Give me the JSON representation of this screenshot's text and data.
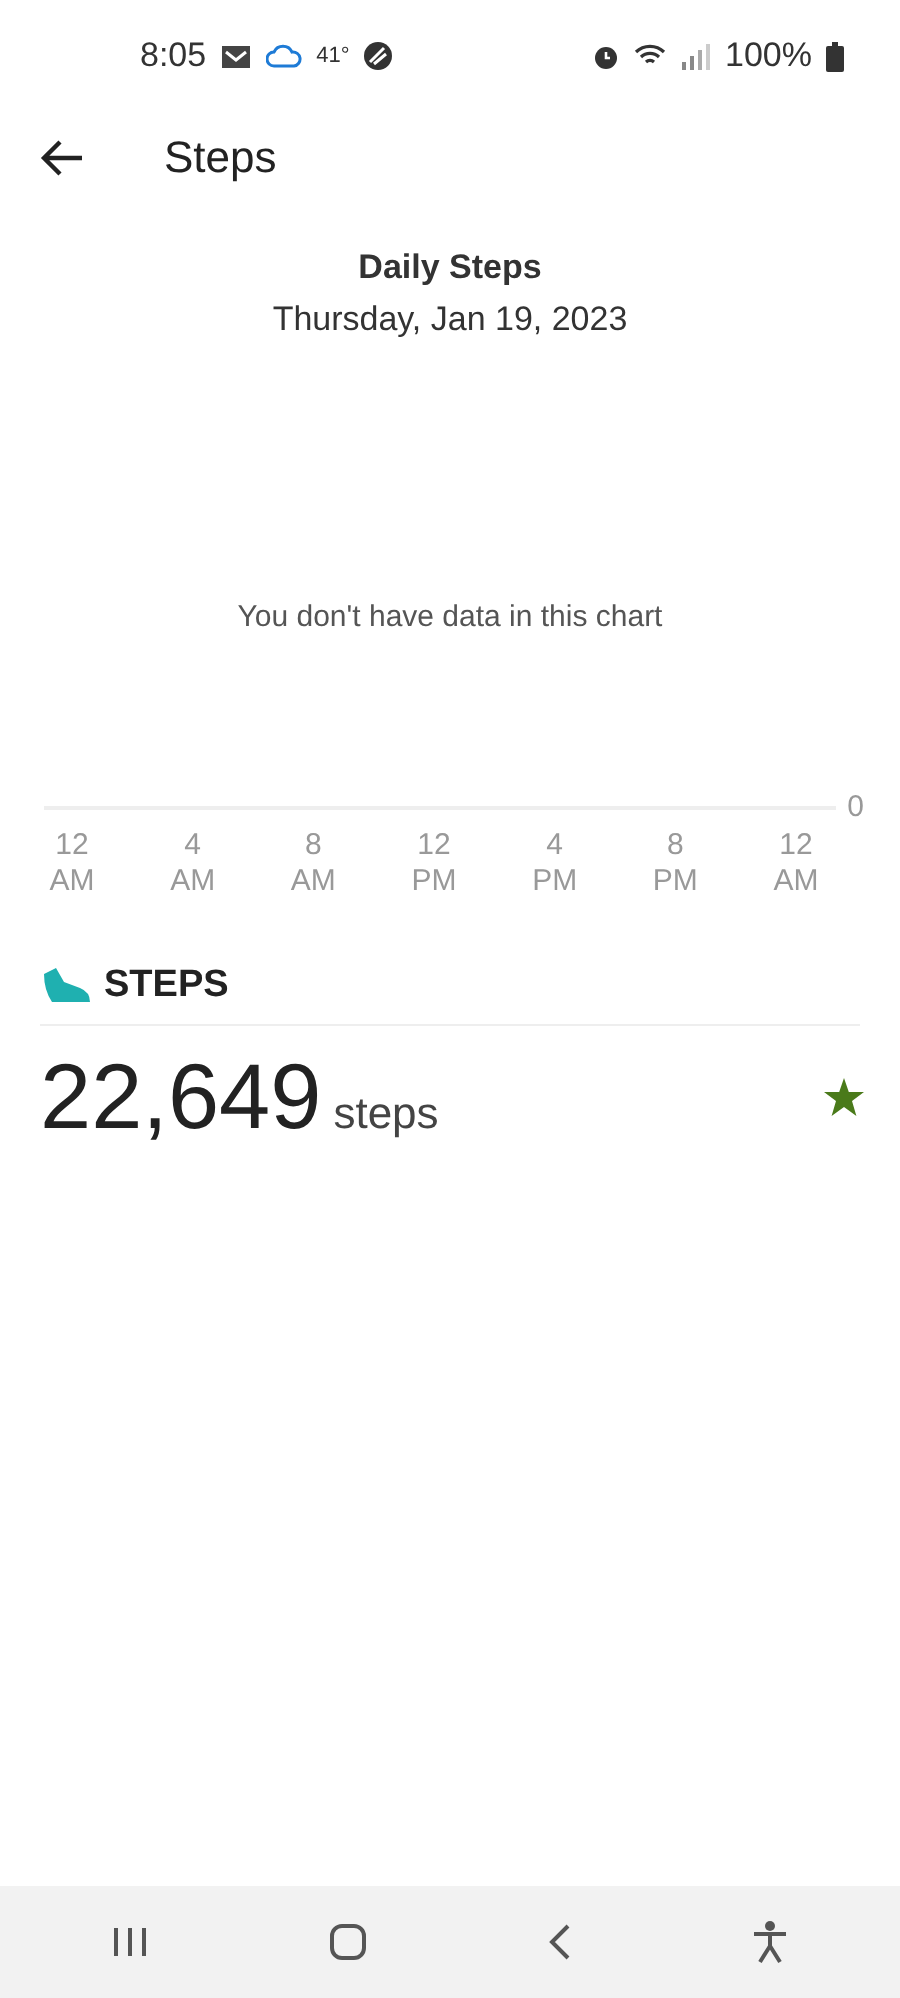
{
  "status_bar": {
    "time": "8:05",
    "temperature": "41°",
    "battery": "100%"
  },
  "header": {
    "title": "Steps"
  },
  "chart": {
    "title": "Daily Steps",
    "date": "Thursday, Jan 19, 2023",
    "empty_message": "You don't have data in this chart",
    "y_tick": "0",
    "x_labels": [
      [
        "12",
        "AM"
      ],
      [
        "4",
        "AM"
      ],
      [
        "8",
        "AM"
      ],
      [
        "12",
        "PM"
      ],
      [
        "4",
        "PM"
      ],
      [
        "8",
        "PM"
      ],
      [
        "12",
        "AM"
      ]
    ]
  },
  "summary": {
    "heading": "STEPS",
    "value": "22,649",
    "unit": "steps"
  }
}
